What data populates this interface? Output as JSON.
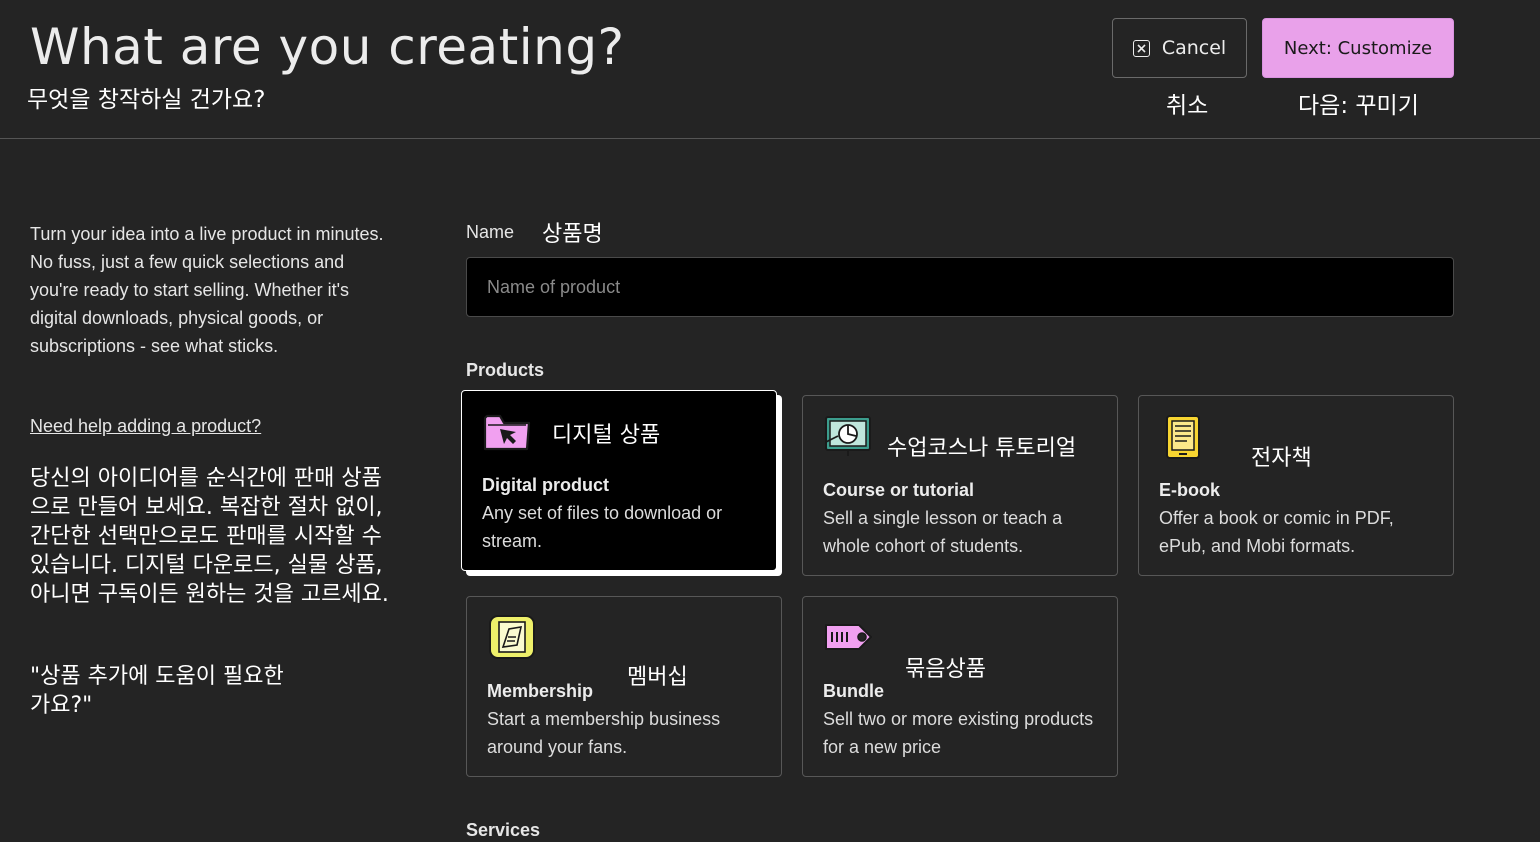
{
  "header": {
    "title": "What are you creating?",
    "title_ko": "무엇을 창작하실 건가요?",
    "cancel_label": "Cancel",
    "cancel_ko": "취소",
    "next_label": "Next: Customize",
    "next_ko": "다음: 꾸미기"
  },
  "intro": {
    "text": "Turn your idea into a live product in minutes. No fuss, just a few quick selections and you're ready to start selling. Whether it's digital downloads, physical goods, or subscriptions - see what sticks.",
    "help_link": "Need help adding a product?",
    "text_ko": "당신의 아이디어를 순식간에 판매 상품으로 만들어 보세요. 복잡한 절차 없이, 간단한 선택만으로도 판매를 시작할 수 있습니다. 디지털 다운로드, 실물 상품, 아니면 구독이든 원하는 것을 고르세요.",
    "help_ko": "\"상품 추가에 도움이 필요한가요?\""
  },
  "form": {
    "name_label": "Name",
    "name_label_ko": "상품명",
    "name_placeholder": "Name of product",
    "name_value": "",
    "products_label": "Products",
    "services_label": "Services"
  },
  "products": [
    {
      "title": "Digital product",
      "title_ko": "디지털 상품",
      "desc": "Any set of files to download or stream.",
      "icon": "folder-cursor-icon",
      "selected": true
    },
    {
      "title": "Course or tutorial",
      "title_ko": "수업코스나 튜토리얼",
      "desc": "Sell a single lesson or teach a whole cohort of students.",
      "icon": "presentation-board-icon",
      "selected": false
    },
    {
      "title": "E-book",
      "title_ko": "전자책",
      "desc": "Offer a book or comic in PDF, ePub, and Mobi formats.",
      "icon": "ebook-reader-icon",
      "selected": false
    },
    {
      "title": "Membership",
      "title_ko": "멤버십",
      "desc": "Start a membership business around your fans.",
      "icon": "membership-card-icon",
      "selected": false
    },
    {
      "title": "Bundle",
      "title_ko": "묶음상품",
      "desc": "Sell two or more existing products for a new price",
      "icon": "price-tag-icon",
      "selected": false
    }
  ],
  "colors": {
    "background": "#242424",
    "accent": "#e9a1ea",
    "icon_pink": "#f1a0f0",
    "icon_teal": "#3c9d8d",
    "icon_yellow": "#f7d531",
    "icon_lime": "#eef06a"
  }
}
